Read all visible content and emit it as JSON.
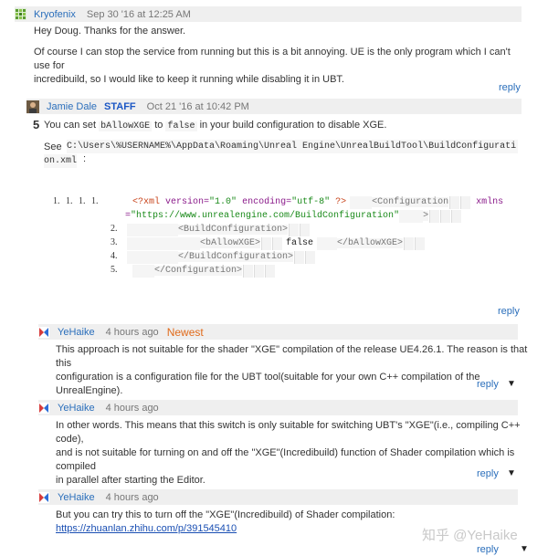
{
  "comment1": {
    "author": "Kryofenix",
    "date": "Sep 30 '16 at 12:25 AM",
    "line1": "Hey Doug. Thanks for the answer.",
    "line2": "Of course I can stop the service from running but this is a bit annoying. UE is the only program which I can't use for",
    "line3": "incredibuild, so I would like to keep it running while disabling it in UBT.",
    "reply": "reply"
  },
  "answer": {
    "author": "Jamie Dale",
    "role": "STAFF",
    "date": "Oct 21 '16 at 10:42 PM",
    "votes": "5",
    "p_a": "You can set",
    "code_a": "bAllowXGE",
    "p_b": "to",
    "code_b": "false",
    "p_c": "in your build configuration to disable XGE.",
    "see": "See",
    "path1": "C:\\Users\\%USERNAME%\\AppData\\Roaming\\Unreal Engine\\UnrealBuildTool\\BuildConfigurati",
    "path2": "on.xml",
    "colon": ":",
    "reply": "reply",
    "code": {
      "ln1": "1.  1.  1.  1.",
      "ln2": "2.",
      "ln3": "3.",
      "ln4": "4.",
      "ln5": "5.",
      "xml_decl_open": "<?xml",
      "xml_ver_attr": "version=",
      "xml_ver_val": "\"1.0\"",
      "xml_enc_attr": "encoding=",
      "xml_enc_val": "\"utf-8\"",
      "xml_decl_close": "?>",
      "cfg_open": "<Configuration",
      "xmlns_a": "xmlns",
      "xmlns_b": "=",
      "xmlns_val": "\"https://www.unrealengine.com/BuildConfiguration\"",
      "cfg_gt": ">",
      "build_open": "<BuildConfiguration>",
      "allow_open": "<bAllowXGE>",
      "allow_val": "false",
      "allow_close": "</bAllowXGE>",
      "build_close": "</BuildConfiguration>",
      "cfg_close": "</Configuration>"
    }
  },
  "comment2": {
    "author": "YeHaike",
    "date": "4 hours ago",
    "badge": "Newest",
    "line1": "This approach is not suitable for the shader \"XGE\" compilation of the release UE4.26.1. The reason is that this",
    "line2": "configuration is a configuration file for the UBT tool(suitable for your own C++ compilation of the UnrealEngine).",
    "reply": "reply"
  },
  "comment3": {
    "author": "YeHaike",
    "date": "4 hours ago",
    "line1": "In other words. This means that this switch is only suitable for switching UBT's \"XGE\"(i.e., compiling C++ code),",
    "line2": "and is not suitable for turning on and off the \"XGE\"(Incredibuild) function of Shader compilation which is compiled",
    "line3": "in parallel after starting the Editor.",
    "reply": "reply"
  },
  "comment4": {
    "author": "YeHaike",
    "date": "4 hours ago",
    "line1": "But you can try this to turn off the \"XGE\"(Incredibuild) of Shader compilation:",
    "link": "https://zhuanlan.zhihu.com/p/391545410",
    "reply": "reply"
  },
  "watermark": "知乎 @YeHaike",
  "arrow_glyph": "▼"
}
